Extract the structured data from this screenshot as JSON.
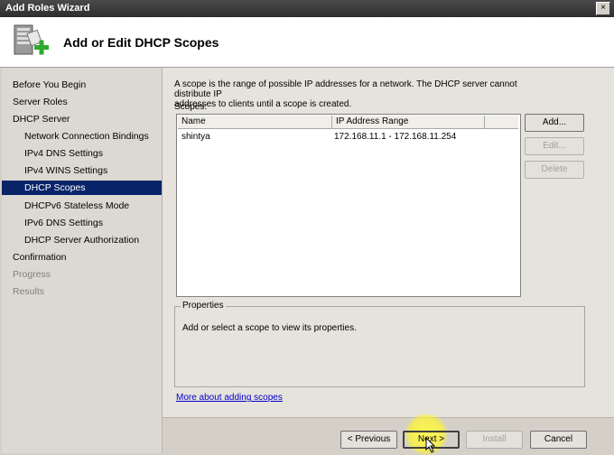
{
  "window": {
    "title": "Add Roles Wizard",
    "close_glyph": "×"
  },
  "header": {
    "title": "Add or Edit DHCP Scopes",
    "icon": "server-add-icon"
  },
  "nav": {
    "items": [
      {
        "label": "Before You Begin",
        "level": 0,
        "state": "normal"
      },
      {
        "label": "Server Roles",
        "level": 0,
        "state": "normal"
      },
      {
        "label": "DHCP Server",
        "level": 0,
        "state": "normal"
      },
      {
        "label": "Network Connection Bindings",
        "level": 1,
        "state": "normal"
      },
      {
        "label": "IPv4 DNS Settings",
        "level": 1,
        "state": "normal"
      },
      {
        "label": "IPv4 WINS Settings",
        "level": 1,
        "state": "normal"
      },
      {
        "label": "DHCP Scopes",
        "level": 1,
        "state": "selected"
      },
      {
        "label": "DHCPv6 Stateless Mode",
        "level": 1,
        "state": "normal"
      },
      {
        "label": "IPv6 DNS Settings",
        "level": 1,
        "state": "normal"
      },
      {
        "label": "DHCP Server Authorization",
        "level": 1,
        "state": "normal"
      },
      {
        "label": "Confirmation",
        "level": 0,
        "state": "normal"
      },
      {
        "label": "Progress",
        "level": 0,
        "state": "disabled"
      },
      {
        "label": "Results",
        "level": 0,
        "state": "disabled"
      }
    ]
  },
  "main": {
    "description_line1": "A scope is the range of possible IP addresses for a network. The DHCP server cannot distribute IP",
    "description_line2": "addresses to clients until a scope is created.",
    "scopes_label": "Scopes:",
    "columns": [
      "Name",
      "IP Address Range"
    ],
    "rows": [
      {
        "name": "shintya",
        "range": "172.168.11.1 - 172.168.11.254"
      }
    ],
    "buttons": {
      "add": "Add...",
      "edit": "Edit...",
      "delete": "Delete"
    },
    "properties": {
      "legend": "Properties",
      "text": "Add or select a scope to view its properties."
    },
    "help_link": "More about adding scopes"
  },
  "footer": {
    "previous": "< Previous",
    "next": "Next >",
    "install": "Install",
    "cancel": "Cancel"
  }
}
